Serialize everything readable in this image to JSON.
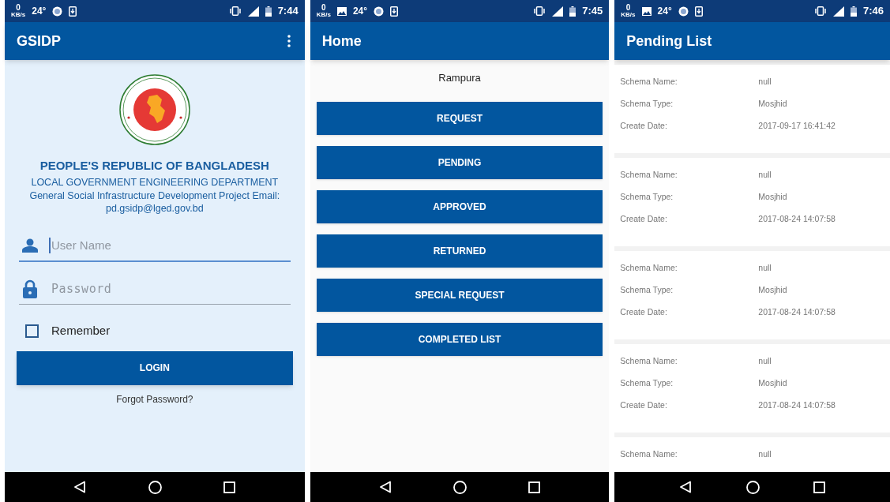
{
  "screens": [
    {
      "kind": "login",
      "status_bar": {
        "speed": "0",
        "speed_unit": "KB/s",
        "photo_notification": false,
        "temperature": "24°",
        "time": "7:44"
      },
      "app_bar": {
        "title": "GSIDP",
        "overflow_menu": true
      },
      "org": {
        "title": "PEOPLE'S REPUBLIC OF BANGLADESH",
        "department": "LOCAL GOVERNMENT ENGINEERING DEPARTMENT",
        "project": "General Social Infrastructure Development Project Email: pd.gsidp@lged.gov.bd"
      },
      "fields": [
        {
          "kind": "user",
          "placeholder": "User Name",
          "focused": true
        },
        {
          "kind": "password",
          "placeholder": "Password",
          "focused": false
        }
      ],
      "remember": {
        "label": "Remember",
        "checked": false
      },
      "login_button": "LOGIN",
      "forgot_link": "Forgot Password?"
    },
    {
      "kind": "home",
      "status_bar": {
        "speed": "0",
        "speed_unit": "KB/s",
        "photo_notification": true,
        "temperature": "24°",
        "time": "7:45"
      },
      "app_bar": {
        "title": "Home",
        "overflow_menu": false
      },
      "location": "Rampura",
      "buttons": [
        "REQUEST",
        "PENDING",
        "APPROVED",
        "RETURNED",
        "SPECIAL REQUEST",
        "COMPLETED LIST"
      ]
    },
    {
      "kind": "pending",
      "status_bar": {
        "speed": "0",
        "speed_unit": "KB/s",
        "photo_notification": true,
        "temperature": "24°",
        "time": "7:46"
      },
      "app_bar": {
        "title": "Pending List",
        "overflow_menu": false
      },
      "items": [
        {
          "fields": [
            {
              "label": "Schema Name:",
              "value": "null"
            },
            {
              "label": "Schema Type:",
              "value": "Mosjhid"
            },
            {
              "label": "Create Date:",
              "value": "2017-09-17 16:41:42"
            }
          ]
        },
        {
          "fields": [
            {
              "label": "Schema Name:",
              "value": "null"
            },
            {
              "label": "Schema Type:",
              "value": "Mosjhid"
            },
            {
              "label": "Create Date:",
              "value": "2017-08-24 14:07:58"
            }
          ]
        },
        {
          "fields": [
            {
              "label": "Schema Name:",
              "value": "null"
            },
            {
              "label": "Schema Type:",
              "value": "Mosjhid"
            },
            {
              "label": "Create Date:",
              "value": "2017-08-24 14:07:58"
            }
          ]
        },
        {
          "fields": [
            {
              "label": "Schema Name:",
              "value": "null"
            },
            {
              "label": "Schema Type:",
              "value": "Mosjhid"
            },
            {
              "label": "Create Date:",
              "value": "2017-08-24 14:07:58"
            }
          ]
        },
        {
          "fields": [
            {
              "label": "Schema Name:",
              "value": "null"
            }
          ]
        }
      ]
    }
  ]
}
